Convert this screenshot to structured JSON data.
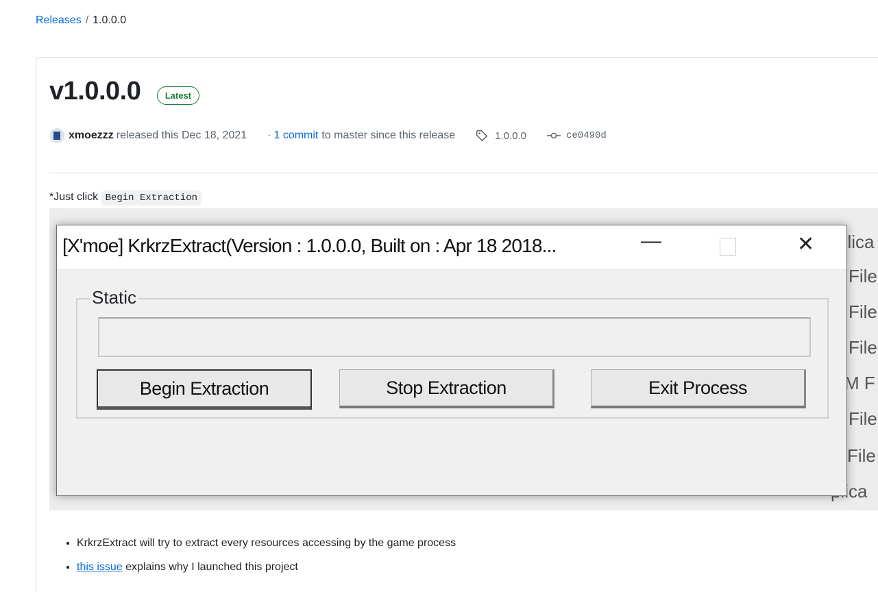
{
  "breadcrumb": {
    "releases": "Releases",
    "separator": "/",
    "current": "1.0.0.0"
  },
  "release": {
    "title": "v1.0.0.0",
    "badge": "Latest",
    "author": "xmoezzz",
    "released_text": "released this Dec 18, 2021",
    "commit_prefix": "·",
    "commit_link": "1 commit",
    "commit_suffix": "to master since this release",
    "tag": "1.0.0.0",
    "commit_hash": "ce0490d"
  },
  "body": {
    "just_click": "*Just click",
    "code": "Begin Extraction",
    "bullets": [
      {
        "text": "KrkrzExtract will try to extract every resources accessing by the game process"
      },
      {
        "link": "this issue",
        "text": " explains why I launched this project"
      }
    ]
  },
  "screenshot": {
    "bg_fragments": [
      "File",
      "File",
      "File",
      "M F",
      "File",
      "File",
      "plica",
      "plica"
    ],
    "window": {
      "title": "[X'moe] KrkrzExtract(Version : 1.0.0.0, Built on : Apr 18 2018...",
      "group_label": "Static",
      "buttons": [
        "Begin Extraction",
        "Stop Extraction",
        "Exit Process"
      ]
    }
  },
  "colors": {
    "link": "#0969da",
    "badge": "#1a7f37"
  }
}
